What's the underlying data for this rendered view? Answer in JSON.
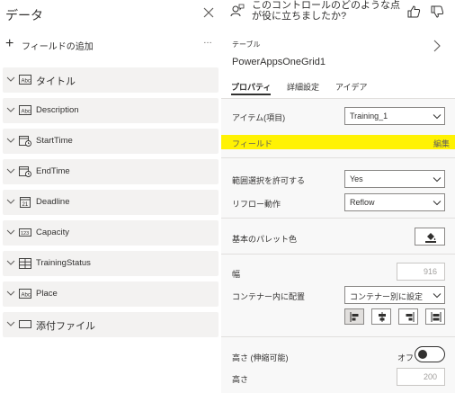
{
  "left_panel": {
    "title": "データ",
    "add_field_label": "フィールドの追加",
    "more_label": "…",
    "fields": [
      {
        "label": "タイトル",
        "icon": "text-field-icon"
      },
      {
        "label": "Description",
        "icon": "text-field-icon"
      },
      {
        "label": "StartTime",
        "icon": "datetime-field-icon"
      },
      {
        "label": "EndTime",
        "icon": "datetime-field-icon"
      },
      {
        "label": "Deadline",
        "icon": "date-field-icon"
      },
      {
        "label": "Capacity",
        "icon": "number-field-icon"
      },
      {
        "label": "TrainingStatus",
        "icon": "choice-field-icon"
      },
      {
        "label": "Place",
        "icon": "text-field-icon"
      },
      {
        "label": "添付ファイル",
        "icon": "attachment-field-icon"
      }
    ]
  },
  "feedback": {
    "text": "このコントロールのどのような点が役に立ちましたか?"
  },
  "control": {
    "kind": "テーブル",
    "name": "PowerAppsOneGrid1"
  },
  "tabs": [
    {
      "label": "プロパティ",
      "active": true
    },
    {
      "label": "詳細設定",
      "active": false
    },
    {
      "label": "アイデア",
      "active": false
    }
  ],
  "properties": {
    "items_label": "アイテム(項目)",
    "items_value": "Training_1",
    "fields_label": "フィールド",
    "fields_edit": "編集",
    "allow_selection_label": "範囲選択を許可する",
    "allow_selection_value": "Yes",
    "reflow_label": "リフロー動作",
    "reflow_value": "Reflow",
    "palette_label": "基本のパレット色",
    "width_label": "幅",
    "width_value": "916",
    "align_label": "コンテナー内に配置",
    "align_value": "コンテナー別に設定",
    "flex_height_label": "高さ (伸縮可能)",
    "flex_height_state": "オフ",
    "height_label": "高さ",
    "height_value": "200"
  },
  "colors": {
    "highlight": "#fff203",
    "panel_bg": "#f8f8f8",
    "field_bg": "#f3f2f1"
  }
}
